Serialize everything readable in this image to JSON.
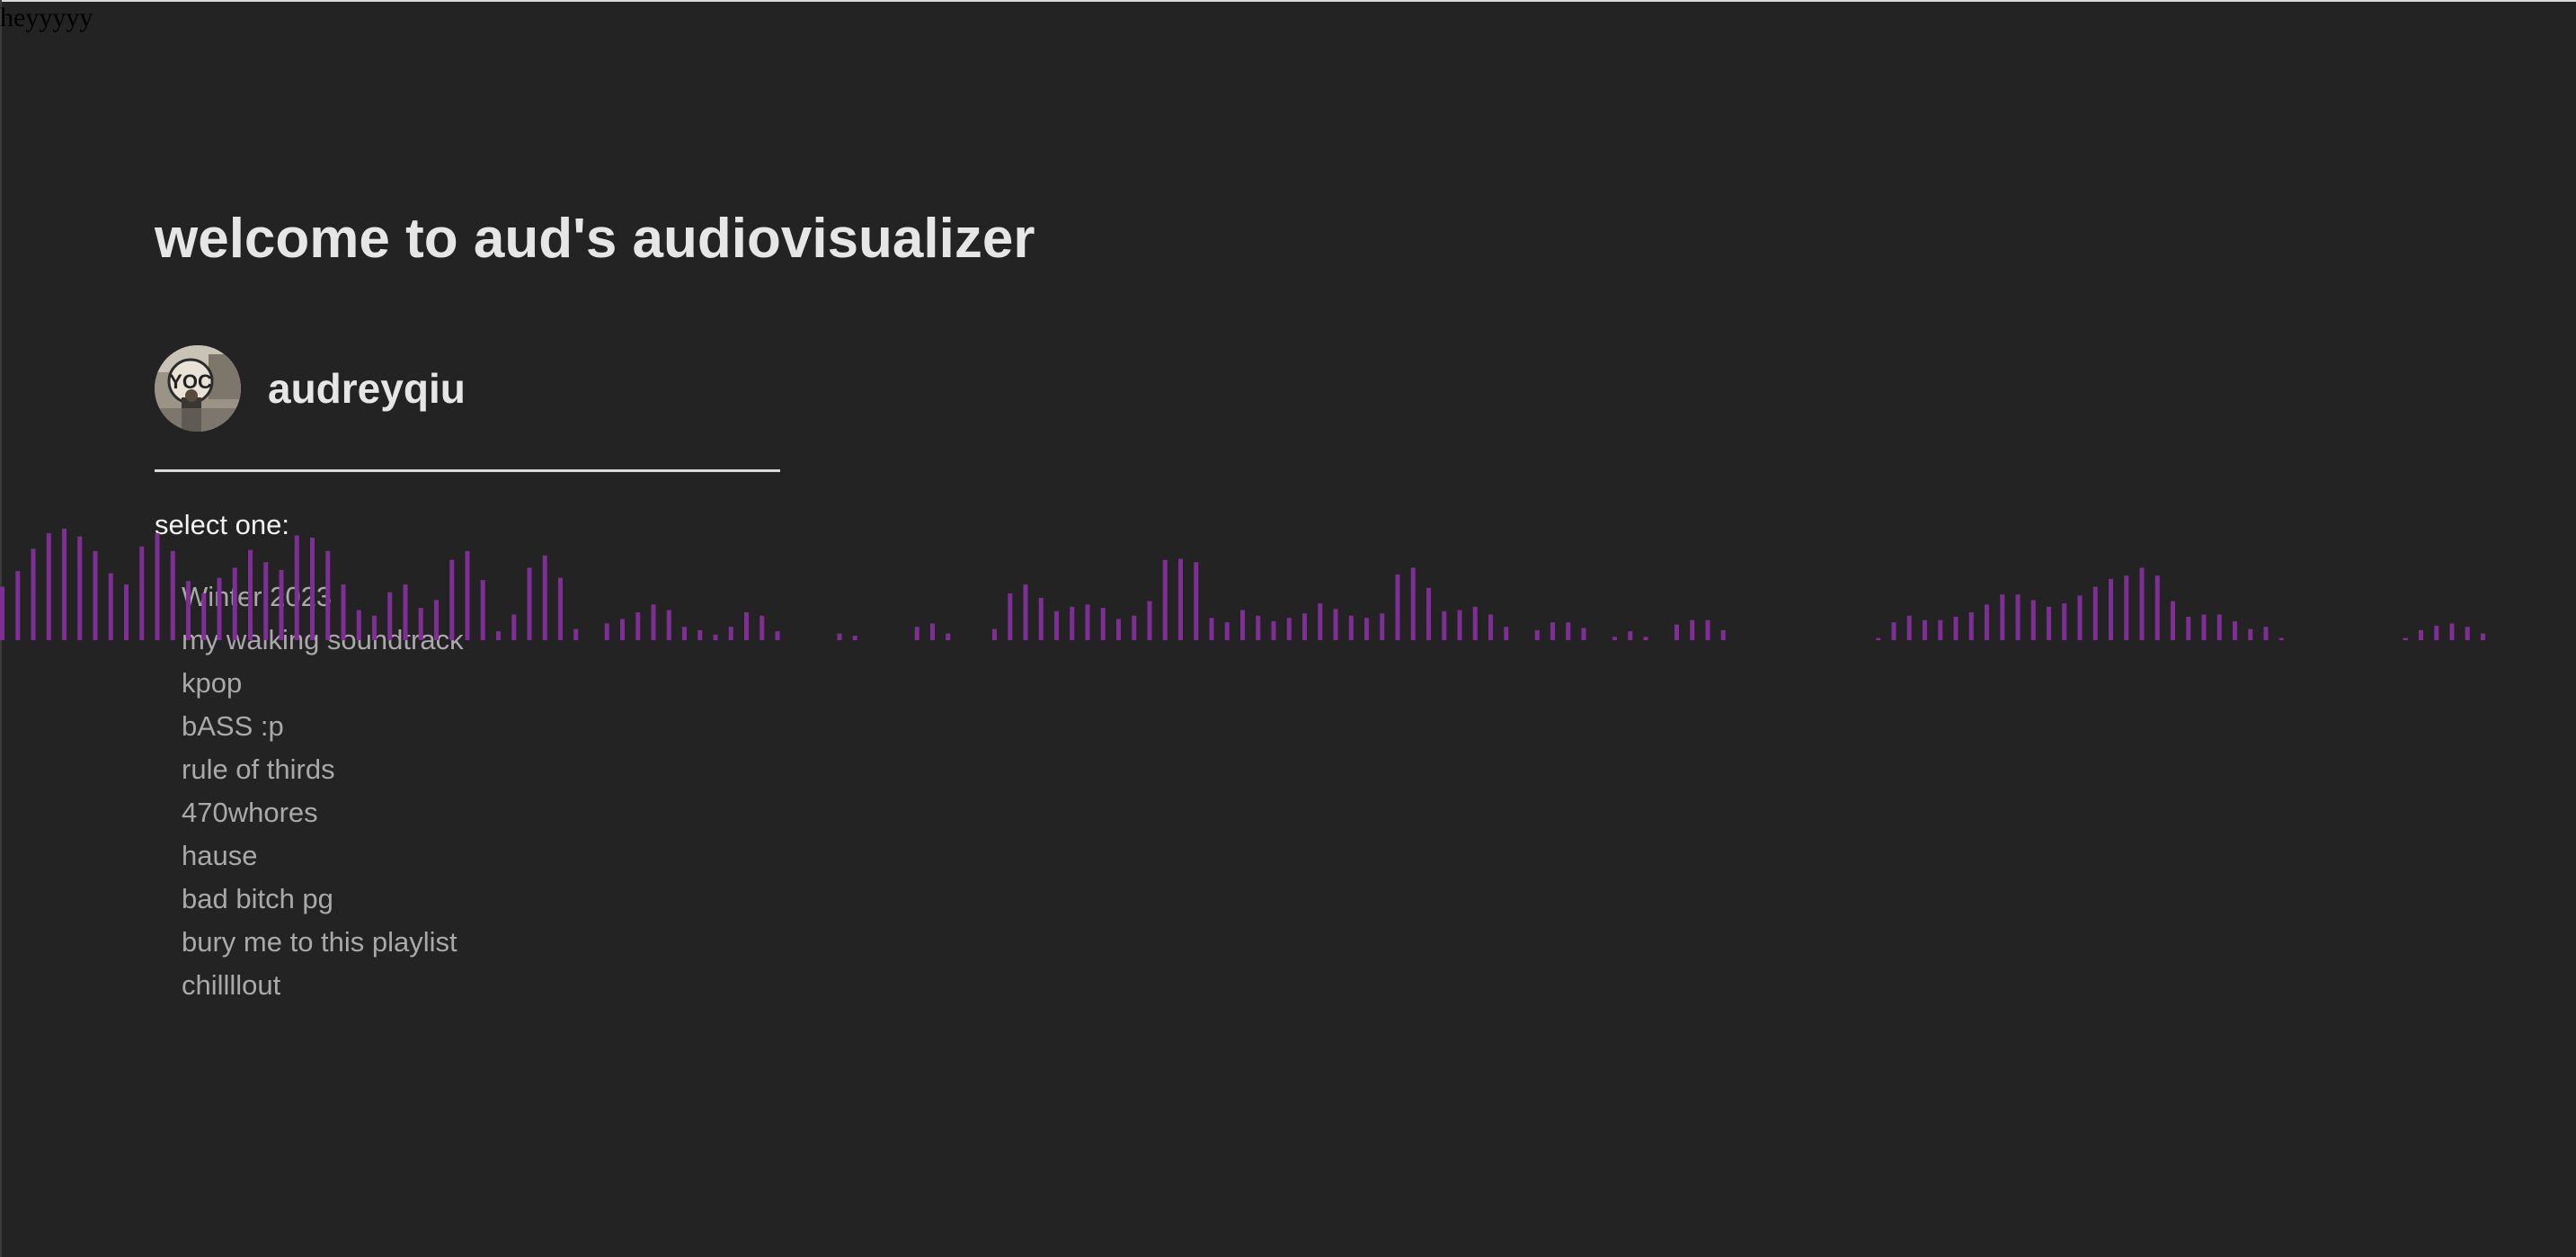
{
  "debug_text": "heyyyyy",
  "title": "welcome to aud's audiovisualizer",
  "profile": {
    "username": "audreyqiu",
    "avatar_icon": "profile-photo"
  },
  "select_label": "select one:",
  "playlists": [
    "Winter 2023",
    "my walking soundtrack",
    "kpop",
    "bASS :p",
    "rule of thirds",
    "470whores",
    "hause",
    "bad bitch pg",
    "bury me to this playlist",
    "chillllout"
  ],
  "visualizer": {
    "bar_color": "#7e2e94",
    "levels": [
      0.48,
      0.62,
      0.82,
      0.96,
      1.0,
      0.93,
      0.8,
      0.6,
      0.5,
      0.84,
      0.96,
      0.8,
      0.53,
      0.42,
      0.56,
      0.65,
      0.81,
      0.7,
      0.63,
      0.94,
      0.92,
      0.8,
      0.5,
      0.27,
      0.22,
      0.43,
      0.5,
      0.29,
      0.36,
      0.72,
      0.8,
      0.54,
      0.08,
      0.23,
      0.65,
      0.76,
      0.56,
      0.1,
      0.0,
      0.15,
      0.19,
      0.25,
      0.32,
      0.27,
      0.12,
      0.09,
      0.05,
      0.12,
      0.25,
      0.22,
      0.08,
      0.0,
      0.0,
      0.0,
      0.06,
      0.04,
      0.0,
      0.0,
      0.0,
      0.12,
      0.15,
      0.06,
      0.0,
      0.0,
      0.1,
      0.42,
      0.5,
      0.38,
      0.26,
      0.3,
      0.32,
      0.29,
      0.19,
      0.22,
      0.35,
      0.72,
      0.73,
      0.7,
      0.2,
      0.16,
      0.27,
      0.22,
      0.17,
      0.2,
      0.24,
      0.33,
      0.28,
      0.22,
      0.2,
      0.24,
      0.59,
      0.65,
      0.47,
      0.26,
      0.27,
      0.3,
      0.23,
      0.12,
      0.0,
      0.09,
      0.16,
      0.16,
      0.11,
      0.0,
      0.03,
      0.08,
      0.03,
      0.0,
      0.14,
      0.18,
      0.18,
      0.09,
      0.0,
      0.0,
      0.0,
      0.0,
      0.0,
      0.0,
      0.0,
      0.0,
      0.0,
      0.02,
      0.16,
      0.22,
      0.18,
      0.18,
      0.21,
      0.25,
      0.32,
      0.41,
      0.41,
      0.36,
      0.3,
      0.33,
      0.4,
      0.48,
      0.55,
      0.58,
      0.65,
      0.58,
      0.35,
      0.21,
      0.23,
      0.23,
      0.17,
      0.1,
      0.12,
      0.02,
      0.0,
      0.0,
      0.0,
      0.0,
      0.0,
      0.0,
      0.0,
      0.02,
      0.09,
      0.13,
      0.15,
      0.12,
      0.06
    ]
  }
}
